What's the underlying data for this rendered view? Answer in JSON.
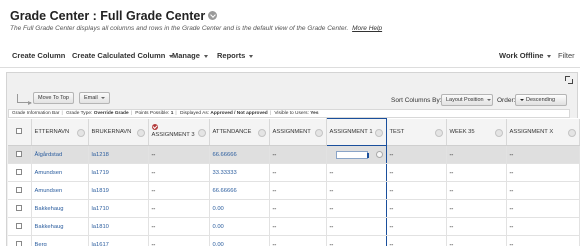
{
  "header": {
    "title": "Grade Center : Full Grade Center",
    "description": "The Full Grade Center displays all columns and rows in the Grade Center and is the default view of the Grade Center.",
    "more_help": "More Help"
  },
  "action_bar": {
    "create_column": "Create Column",
    "create_calculated_column": "Create Calculated Column",
    "manage": "Manage",
    "reports": "Reports",
    "work_offline": "Work Offline",
    "filter": "Filter"
  },
  "toolbar": {
    "move_to_top": "Move To Top",
    "email": "Email",
    "sort_columns_by_label": "Sort Columns By:",
    "sort_columns_value": "Layout Position",
    "order_label": "Order:",
    "order_value": "Descending"
  },
  "info_bar": {
    "label": "Grade Information Bar",
    "grade_type_label": "Grade Type:",
    "grade_type_value": "Override Grade",
    "points_possible_label": "Points Possible:",
    "points_possible_value": "1",
    "displayed_as_label": "Displayed As:",
    "displayed_as_value": "Approved / Not approved",
    "visible_label": "Visible to Users:",
    "visible_value": "Yes"
  },
  "columns": [
    "ETTERNAVN",
    "BRUKERNAVN",
    "ASSIGNMENT 3",
    "ATTENDANCE",
    "ASSIGNMENT",
    "ASSIGNMENT 1",
    "TEST",
    "WEEK 35",
    "ASSIGNMENT X"
  ],
  "selected_column": "ASSIGNMENT 1",
  "rows": [
    {
      "etternavn": "Ålgårdstad",
      "brukernavn": "la1218",
      "assignment3": "--",
      "attendance": "66.66666",
      "assignment": "--",
      "assignment1": "",
      "test": "--",
      "week35": "--",
      "assignmentx": "--"
    },
    {
      "etternavn": "Amundsen",
      "brukernavn": "la1719",
      "assignment3": "--",
      "attendance": "33.33333",
      "assignment": "--",
      "assignment1": "--",
      "test": "--",
      "week35": "--",
      "assignmentx": "--"
    },
    {
      "etternavn": "Amundsen",
      "brukernavn": "la1819",
      "assignment3": "--",
      "attendance": "66.66666",
      "assignment": "--",
      "assignment1": "--",
      "test": "--",
      "week35": "--",
      "assignmentx": "--"
    },
    {
      "etternavn": "Bakkehaug",
      "brukernavn": "la1710",
      "assignment3": "--",
      "attendance": "0.00",
      "assignment": "--",
      "assignment1": "--",
      "test": "--",
      "week35": "--",
      "assignmentx": "--"
    },
    {
      "etternavn": "Bakkehaug",
      "brukernavn": "la1810",
      "assignment3": "--",
      "attendance": "0.00",
      "assignment": "--",
      "assignment1": "--",
      "test": "--",
      "week35": "--",
      "assignmentx": "--"
    },
    {
      "etternavn": "Berg",
      "brukernavn": "la1617",
      "assignment3": "--",
      "attendance": "0.00",
      "assignment": "--",
      "assignment1": "--",
      "test": "--",
      "week35": "--",
      "assignmentx": "--"
    }
  ],
  "colors": {
    "selection_border": "#1a4f9c",
    "link": "#2b5d9e",
    "highlight_row": "#dfdfdf"
  }
}
